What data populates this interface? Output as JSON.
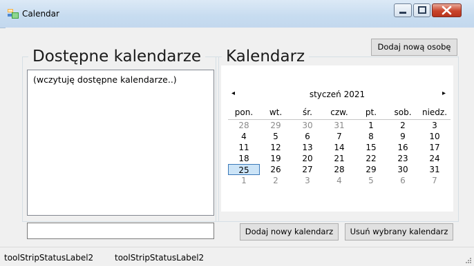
{
  "window": {
    "title": "Calendar"
  },
  "buttons": {
    "add_person": "Dodaj nową osobę",
    "add_calendar": "Dodaj nowy kalendarz",
    "remove_calendar": "Usuń wybrany kalendarz"
  },
  "groups": {
    "available_title": "Dostępne kalendarze",
    "calendar_title": "Kalendarz"
  },
  "listbox": {
    "items": [
      "(wczytuję dostępne kalendarze..)"
    ]
  },
  "name_input": {
    "value": ""
  },
  "calendar": {
    "month_label": "styczeń 2021",
    "prev_glyph": "◂",
    "next_glyph": "▸",
    "weekdays": [
      "pon.",
      "wt.",
      "śr.",
      "czw.",
      "pt.",
      "sob.",
      "niedz."
    ],
    "weeks": [
      [
        "28",
        "29",
        "30",
        "31",
        "1",
        "2",
        "3"
      ],
      [
        "4",
        "5",
        "6",
        "7",
        "8",
        "9",
        "10"
      ],
      [
        "11",
        "12",
        "13",
        "14",
        "15",
        "16",
        "17"
      ],
      [
        "18",
        "19",
        "20",
        "21",
        "22",
        "23",
        "24"
      ],
      [
        "25",
        "26",
        "27",
        "28",
        "29",
        "30",
        "31"
      ],
      [
        "1",
        "2",
        "3",
        "4",
        "5",
        "6",
        "7"
      ]
    ]
  },
  "status": {
    "label1": "toolStripStatusLabel2",
    "label2": "toolStripStatusLabel2"
  },
  "colors": {
    "today_border": "#3a78b8",
    "today_fill": "#cce4f7",
    "other_month": "#8a8a8a"
  }
}
